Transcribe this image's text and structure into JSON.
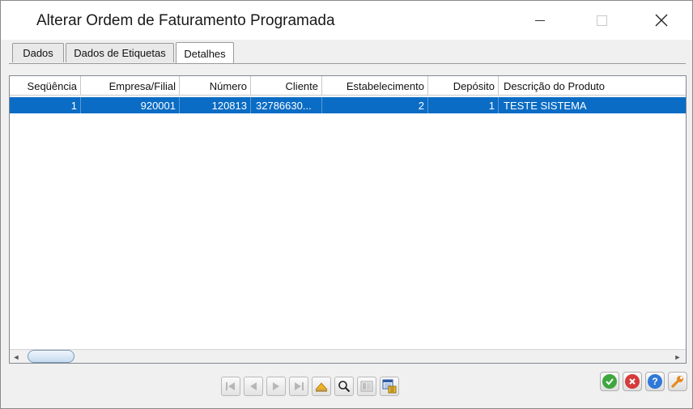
{
  "window": {
    "title": "Alterar Ordem de Faturamento Programada",
    "close_glyph": "✕"
  },
  "tabs": [
    {
      "label": "Dados",
      "active": false
    },
    {
      "label": "Dados de Etiquetas",
      "active": false
    },
    {
      "label": "Detalhes",
      "active": true
    }
  ],
  "grid": {
    "columns": [
      "Seqüência",
      "Empresa/Filial",
      "Número",
      "Cliente",
      "Estabelecimento",
      "Depósito",
      "Descrição do Produto"
    ],
    "rows": [
      [
        "1",
        "920001",
        "120813",
        "32786630...",
        "2",
        "1",
        "TESTE SISTEMA"
      ]
    ],
    "selected_row": 0
  },
  "scrollbar": {
    "left_arrow": "◄",
    "right_arrow": "►"
  },
  "navigation": {
    "buttons": [
      "first-icon",
      "previous-icon",
      "next-icon",
      "last-icon",
      "collapse-icon",
      "search-icon",
      "grid-view-icon",
      "export-icon"
    ]
  },
  "actions": {
    "confirm_icon": "check-icon",
    "cancel_icon": "cancel-icon",
    "help_glyph": "?",
    "settings_icon": "wrench-icon"
  },
  "colors": {
    "selection": "#0a6cc4",
    "confirm": "#3fa63f",
    "cancel": "#d63a3a",
    "help": "#2f78d8",
    "settings": "#e58a1f"
  }
}
